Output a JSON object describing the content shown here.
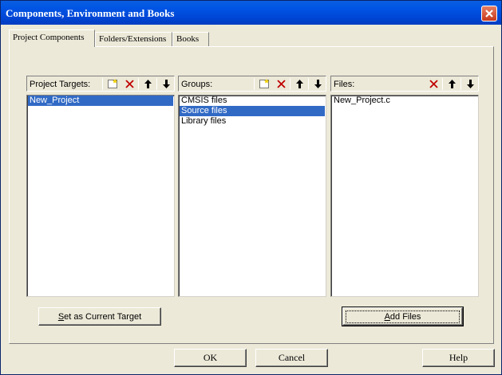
{
  "window": {
    "title": "Components, Environment and Books"
  },
  "tabs": [
    {
      "label": "Project Components",
      "active": true
    },
    {
      "label": "Folders/Extensions",
      "active": false
    },
    {
      "label": "Books",
      "active": false
    }
  ],
  "targets": {
    "label": "Project Targets:",
    "items": [
      {
        "text": "New_Project",
        "selected": true
      }
    ]
  },
  "groups": {
    "label": "Groups:",
    "items": [
      {
        "text": "CMSIS files",
        "selected": false
      },
      {
        "text": "Source files",
        "selected": true
      },
      {
        "text": "Library files",
        "selected": false
      }
    ]
  },
  "files": {
    "label": "Files:",
    "items": [
      {
        "text": "New_Project.c",
        "selected": false
      }
    ]
  },
  "buttons": {
    "set_current_target_hotkey": "S",
    "set_current_target_rest": "et as Current Target",
    "add_files_hotkey": "A",
    "add_files_rest": "dd Files",
    "ok": "OK",
    "cancel": "Cancel",
    "help": "Help"
  },
  "colors": {
    "selection": "#316ac5",
    "titlebar": "#0055e5",
    "dialog_bg": "#ece9d8"
  }
}
